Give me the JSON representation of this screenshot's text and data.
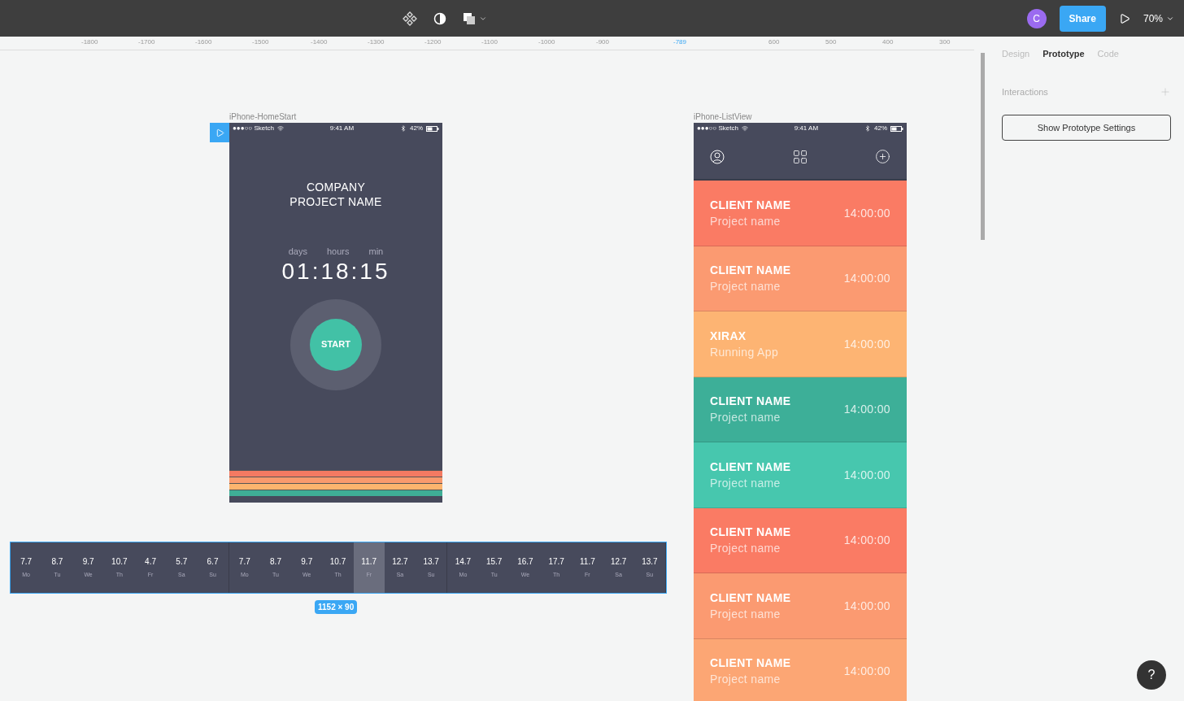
{
  "toolbar": {
    "avatar": "C",
    "share": "Share",
    "zoom": "70%"
  },
  "ruler": [
    "-1800",
    "-1700",
    "-1600",
    "-1500",
    "-1400",
    "-1300",
    "-1200",
    "-1100",
    "-1000",
    "-900",
    "-789",
    "600",
    "500",
    "400",
    "300"
  ],
  "panel": {
    "tabs": [
      {
        "label": "Design",
        "selected": false
      },
      {
        "label": "Prototype",
        "selected": true
      },
      {
        "label": "Code",
        "selected": false
      }
    ],
    "interactions": "Interactions",
    "settings_button": "Show Prototype Settings"
  },
  "home_frame": {
    "name": "iPhone-HomeStart",
    "status": {
      "carrier": "●●●○○ Sketch",
      "time": "9:41 AM",
      "battery": "42%"
    },
    "title": [
      "COMPANY",
      "PROJECT NAME"
    ],
    "units": [
      "days",
      "hours",
      "min"
    ],
    "timer": "01:18:15",
    "start": "START",
    "stripes": [
      {
        "color": "#f47a62"
      },
      {
        "color": "#f99a6d"
      },
      {
        "color": "#fcb46e"
      },
      {
        "color": "#3fae96"
      }
    ]
  },
  "list_frame": {
    "name": "iPhone-ListView",
    "status": {
      "carrier": "●●●○○ Sketch",
      "time": "9:41 AM",
      "battery": "42%"
    },
    "rows": [
      {
        "title": "CLIENT NAME",
        "subtitle": "Project name",
        "time": "14:00:00",
        "color": "#fa7b64"
      },
      {
        "title": "CLIENT NAME",
        "subtitle": "Project name",
        "time": "14:00:00",
        "color": "#fb9a71"
      },
      {
        "title": "XIRAX",
        "subtitle": "Running App",
        "time": "14:00:00",
        "color": "#fdb473"
      },
      {
        "title": "CLIENT NAME",
        "subtitle": "Project name",
        "time": "14:00:00",
        "color": "#3daf98"
      },
      {
        "title": "CLIENT NAME",
        "subtitle": "Project name",
        "time": "14:00:00",
        "color": "#47c7ae"
      },
      {
        "title": "CLIENT NAME",
        "subtitle": "Project name",
        "time": "14:00:00",
        "color": "#fa7b64"
      },
      {
        "title": "CLIENT NAME",
        "subtitle": "Project name",
        "time": "14:00:00",
        "color": "#fb9a71"
      },
      {
        "title": "CLIENT NAME",
        "subtitle": "Project name",
        "time": "14:00:00",
        "color": "#fca674"
      }
    ]
  },
  "calendar": {
    "weeks": [
      [
        {
          "date": "7.7",
          "day": "Mo",
          "selected": false
        },
        {
          "date": "8.7",
          "day": "Tu",
          "selected": false
        },
        {
          "date": "9.7",
          "day": "We",
          "selected": false
        },
        {
          "date": "10.7",
          "day": "Th",
          "selected": false
        },
        {
          "date": "4.7",
          "day": "Fr",
          "selected": false
        },
        {
          "date": "5.7",
          "day": "Sa",
          "selected": false
        },
        {
          "date": "6.7",
          "day": "Su",
          "selected": false
        }
      ],
      [
        {
          "date": "7.7",
          "day": "Mo",
          "selected": false
        },
        {
          "date": "8.7",
          "day": "Tu",
          "selected": false
        },
        {
          "date": "9.7",
          "day": "We",
          "selected": false
        },
        {
          "date": "10.7",
          "day": "Th",
          "selected": false
        },
        {
          "date": "11.7",
          "day": "Fr",
          "selected": true
        },
        {
          "date": "12.7",
          "day": "Sa",
          "selected": false
        },
        {
          "date": "13.7",
          "day": "Su",
          "selected": false
        }
      ],
      [
        {
          "date": "14.7",
          "day": "Mo",
          "selected": false
        },
        {
          "date": "15.7",
          "day": "Tu",
          "selected": false
        },
        {
          "date": "16.7",
          "day": "We",
          "selected": false
        },
        {
          "date": "17.7",
          "day": "Th",
          "selected": false
        },
        {
          "date": "11.7",
          "day": "Fr",
          "selected": false
        },
        {
          "date": "12.7",
          "day": "Sa",
          "selected": false
        },
        {
          "date": "13.7",
          "day": "Su",
          "selected": false
        }
      ]
    ],
    "size_label": "1152 × 90"
  },
  "help": "?"
}
